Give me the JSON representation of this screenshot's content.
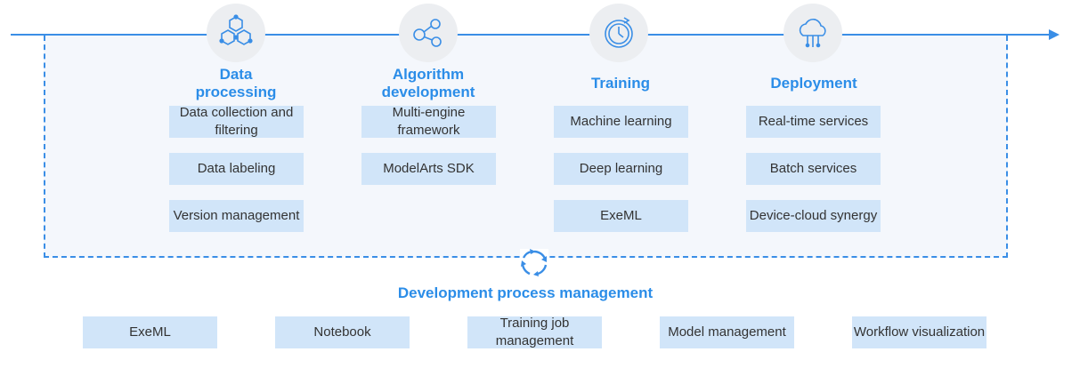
{
  "stages": [
    {
      "title_line1": "Data",
      "title_line2": "processing",
      "icon": "molecule-icon",
      "items": [
        "Data collection and filtering",
        "Data labeling",
        "Version management"
      ]
    },
    {
      "title_line1": "Algorithm",
      "title_line2": "development",
      "icon": "share-nodes-icon",
      "items": [
        "Multi-engine framework",
        "ModelArts SDK"
      ]
    },
    {
      "title_line1": "Training",
      "title_line2": "",
      "icon": "stopwatch-icon",
      "items": [
        "Machine learning",
        "Deep learning",
        "ExeML"
      ]
    },
    {
      "title_line1": "Deployment",
      "title_line2": "",
      "icon": "cloud-circuit-icon",
      "items": [
        "Real-time services",
        "Batch services",
        "Device-cloud synergy"
      ]
    }
  ],
  "process_management": {
    "title": "Development process management",
    "icon": "cycle-arrows-icon",
    "items": [
      "ExeML",
      "Notebook",
      "Training job management",
      "Model management",
      "Workflow visualization"
    ]
  },
  "colors": {
    "accent": "#2b8de8",
    "line": "#3a8ee6",
    "box_fill": "#d1e5f9",
    "panel_fill": "#f4f7fc",
    "icon_bg": "#eceef1"
  }
}
